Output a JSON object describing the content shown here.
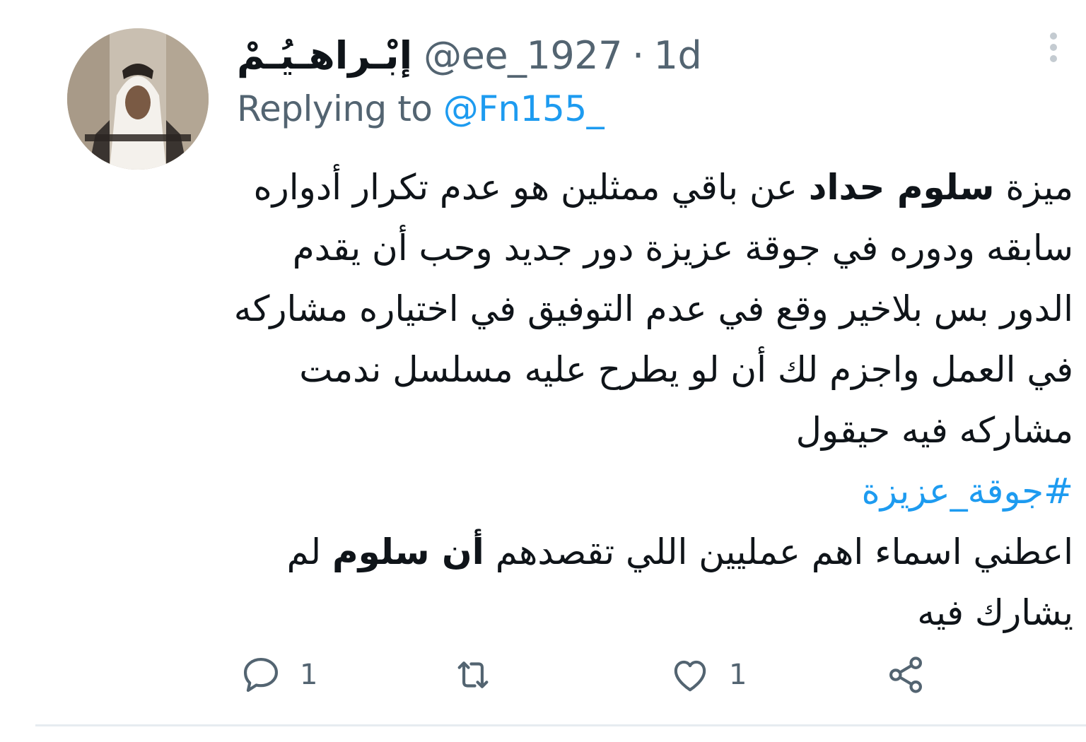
{
  "tweet": {
    "display_name": "إبْـراهـيُـمْ",
    "handle": "@ee_1927",
    "separator": "·",
    "time": "1d",
    "replying_prefix": "Replying to",
    "replying_to": "@Fn155_",
    "body": {
      "p1_a": "ميزة ",
      "p1_b": "سلوم حداد",
      "p1_c": " عن باقي ممثلين هو عدم تكرار أدواره سابقه ودوره في جوقة عزيزة دور جديد وحب أن يقدم الدور بس بلاخير وقع في عدم التوفيق في اختياره مشاركه في العمل واجزم لك أن لو يطرح عليه مسلسل ندمت مشاركه فيه حيقول",
      "hashtag": "#جوقة_عزيزة",
      "p3_a": "اعطني اسماء اهم عمليين اللي تقصدهم ",
      "p3_b": "أن سلوم",
      "p3_c": " لم يشارك فيه"
    }
  },
  "actions": {
    "reply_count": "1",
    "like_count": "1"
  },
  "icons": {
    "more": "more-vertical-icon",
    "reply": "reply-bubble-icon",
    "retweet": "retweet-icon",
    "like": "heart-icon",
    "share": "share-icon"
  },
  "colors": {
    "primary_text": "#0f1419",
    "secondary_text": "#536471",
    "link": "#1d9bf0",
    "divider": "#e6ecf0"
  }
}
